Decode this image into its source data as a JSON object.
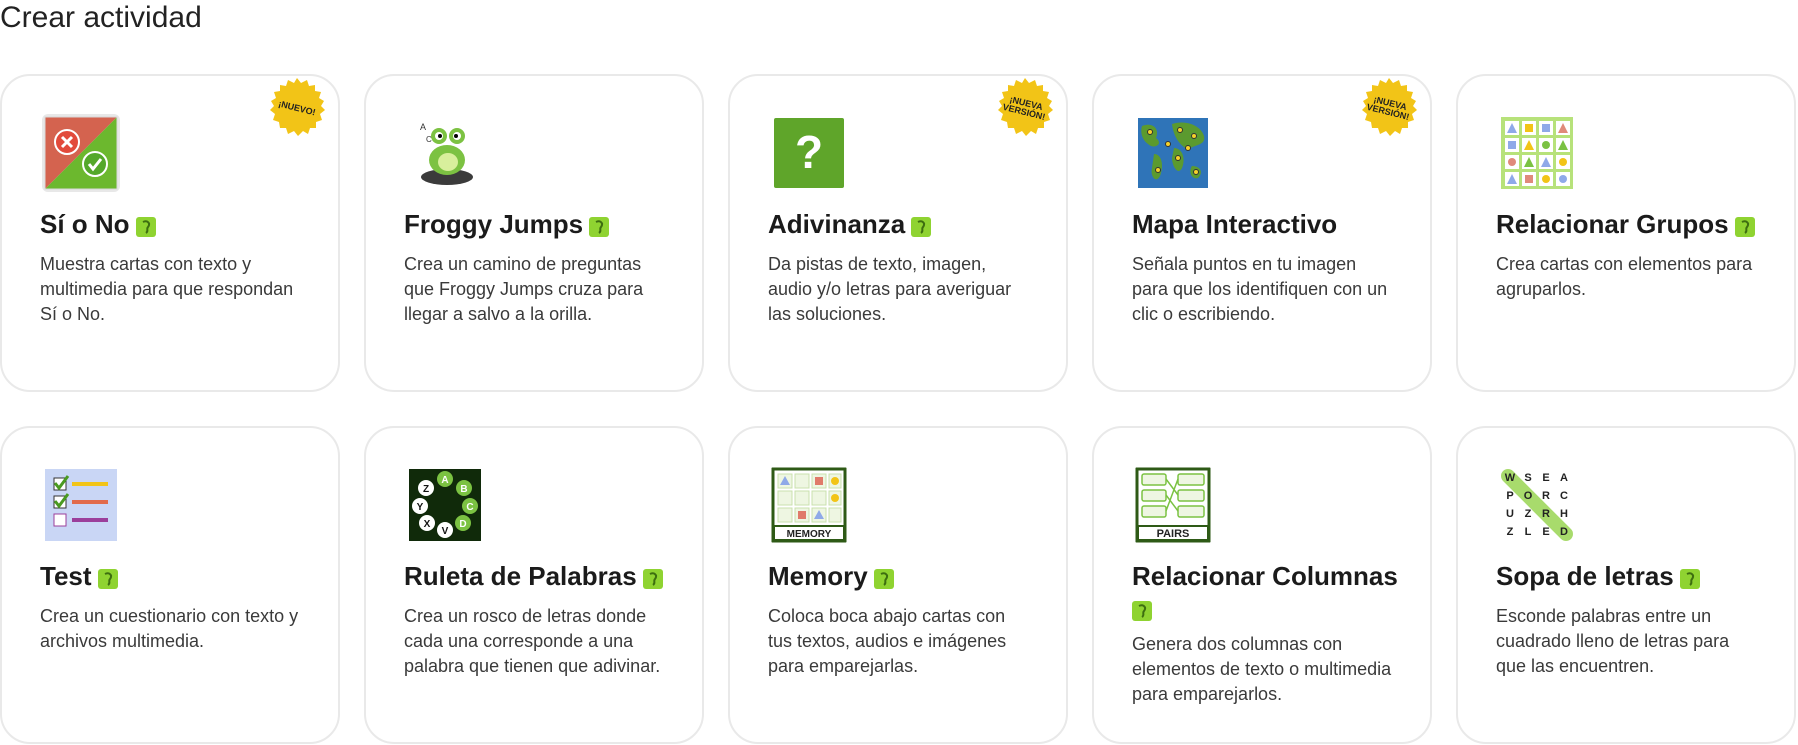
{
  "page": {
    "title": "Crear actividad"
  },
  "colors": {
    "accent_green": "#8fd331",
    "badge_yellow": "#f2c417",
    "card_border": "#e9e9e9"
  },
  "cards": [
    {
      "title": "Sí o No",
      "description": "Muestra cartas con texto y multimedia para que respondan Sí o No.",
      "badge": "¡NUEVO!",
      "icon": "si-o-no-icon"
    },
    {
      "title": "Froggy Jumps",
      "description": "Crea un camino de preguntas que Froggy Jumps cruza para llegar a salvo a la orilla.",
      "icon": "frog-icon"
    },
    {
      "title": "Adivinanza",
      "description": "Da pistas de texto, imagen, audio y/o letras para averiguar las soluciones.",
      "badge": "¡NUEVA VERSIÓN!",
      "icon": "question-mark-icon"
    },
    {
      "title": "Mapa Interactivo",
      "description": "Señala puntos en tu imagen para que los identifiquen con un clic o escribiendo.",
      "badge": "¡NUEVA VERSIÓN!",
      "icon": "world-map-icon"
    },
    {
      "title": "Relacionar Grupos",
      "description": "Crea cartas con elementos para agruparlos.",
      "icon": "shape-grid-icon"
    },
    {
      "title": "Test",
      "description": "Crea un cuestionario con texto y archivos multimedia.",
      "icon": "checklist-icon"
    },
    {
      "title": "Ruleta de Palabras",
      "description": "Crea un rosco de letras donde cada una corresponde a una palabra que tienen que adivinar.",
      "icon": "letter-wheel-icon",
      "wheel_letters": [
        "A",
        "B",
        "C",
        "D",
        "V",
        "X",
        "Y",
        "Z"
      ]
    },
    {
      "title": "Memory",
      "description": "Coloca boca abajo cartas con tus textos, audios e imágenes para emparejarlas.",
      "icon": "memory-cards-icon",
      "thumb_label": "MEMORY"
    },
    {
      "title": "Relacionar Columnas",
      "description": "Genera dos columnas con elementos de texto o multimedia para emparejarlos.",
      "icon": "pairs-columns-icon",
      "thumb_label": "PAIRS"
    },
    {
      "title": "Sopa de letras",
      "description": "Esconde palabras entre un cuadrado lleno de letras para que las encuentren.",
      "icon": "word-search-icon",
      "grid": [
        "W",
        "S",
        "E",
        "A",
        "P",
        "O",
        "R",
        "C",
        "U",
        "Z",
        "R",
        "H",
        "Z",
        "L",
        "E",
        "D"
      ]
    }
  ]
}
